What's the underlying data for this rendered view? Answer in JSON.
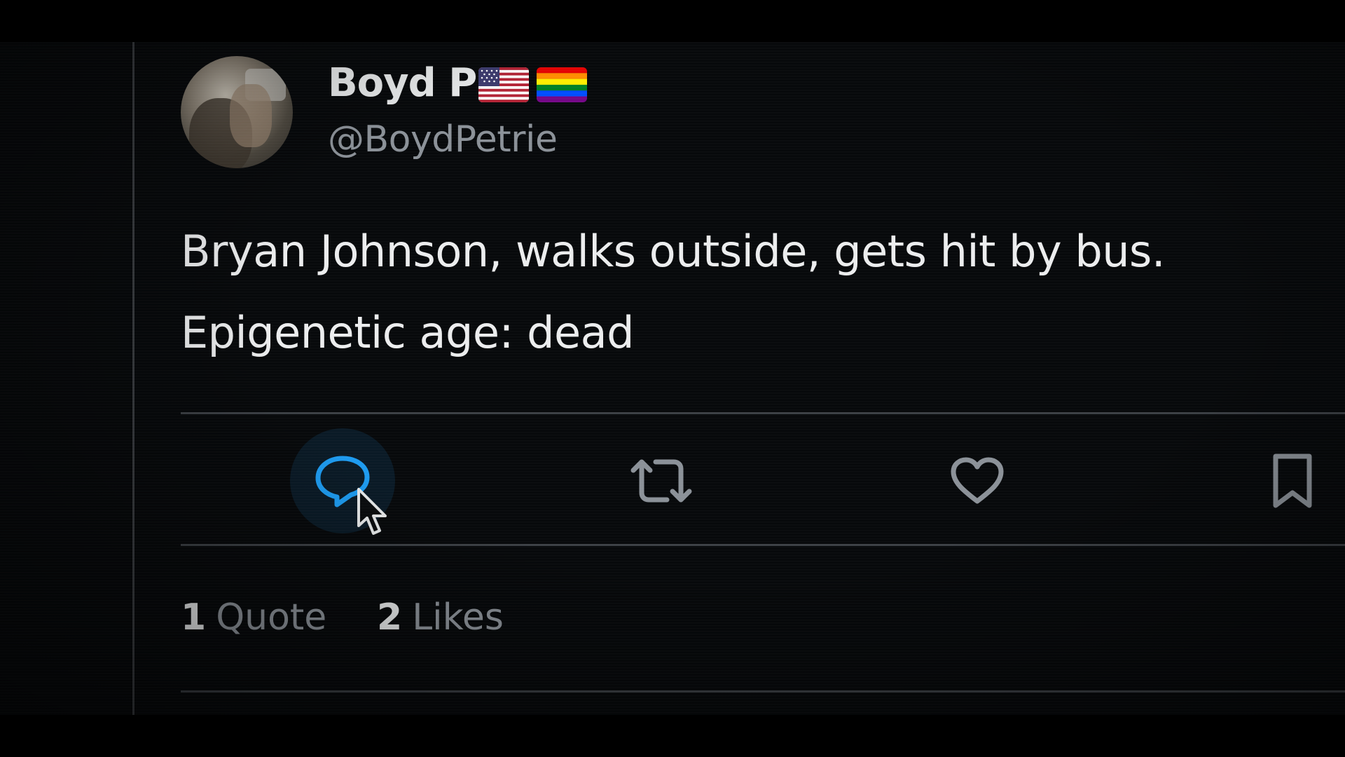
{
  "author": {
    "display_name": "Boyd P",
    "handle": "@BoydPetrie",
    "flags": [
      "us-flag-icon",
      "pride-flag-icon"
    ]
  },
  "tweet": {
    "lines": [
      "Bryan Johnson, walks outside, gets hit by bus.",
      "Epigenetic age: dead"
    ]
  },
  "actions": {
    "reply_icon": "reply-icon",
    "retweet_icon": "retweet-icon",
    "like_icon": "heart-icon",
    "bookmark_icon": "bookmark-icon"
  },
  "stats": {
    "quotes_count": "1",
    "quotes_label": "Quote",
    "likes_count": "2",
    "likes_label": "Likes"
  },
  "colors": {
    "background": "#07090b",
    "text_primary": "#e7e9ea",
    "text_secondary": "#8b9198",
    "accent": "#1d9bf0",
    "divider": "#3b3f44"
  }
}
